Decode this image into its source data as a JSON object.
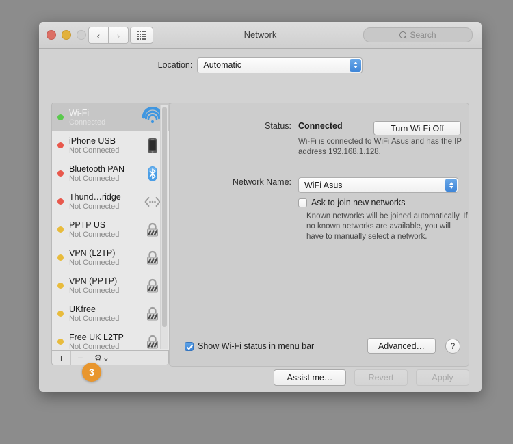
{
  "window": {
    "title": "Network",
    "traffic_lights": [
      "close",
      "minimize",
      "zoom"
    ],
    "nav_back_icon": "chevron-left-icon",
    "nav_forward_icon": "chevron-right-icon",
    "show_all_icon": "grid-icon",
    "search_placeholder": "Search"
  },
  "location": {
    "label": "Location:",
    "value": "Automatic"
  },
  "sidebar": {
    "services": [
      {
        "name": "Wi-Fi",
        "status": "Connected",
        "dot": "green",
        "icon": "wifi-icon",
        "selected": true
      },
      {
        "name": "iPhone USB",
        "status": "Not Connected",
        "dot": "red",
        "icon": "iphone-icon",
        "selected": false
      },
      {
        "name": "Bluetooth PAN",
        "status": "Not Connected",
        "dot": "red",
        "icon": "bluetooth-icon",
        "selected": false
      },
      {
        "name": "Thund…ridge",
        "status": "Not Connected",
        "dot": "red",
        "icon": "thunderbolt-icon",
        "selected": false
      },
      {
        "name": "PPTP US",
        "status": "Not Connected",
        "dot": "yellow",
        "icon": "vpn-lock-icon",
        "selected": false
      },
      {
        "name": "VPN (L2TP)",
        "status": "Not Connected",
        "dot": "yellow",
        "icon": "vpn-lock-icon",
        "selected": false
      },
      {
        "name": "VPN (PPTP)",
        "status": "Not Connected",
        "dot": "yellow",
        "icon": "vpn-lock-icon",
        "selected": false
      },
      {
        "name": "UKfree",
        "status": "Not Connected",
        "dot": "yellow",
        "icon": "vpn-lock-icon",
        "selected": false
      },
      {
        "name": "Free UK L2TP",
        "status": "Not Connected",
        "dot": "yellow",
        "icon": "vpn-lock-icon",
        "selected": false
      }
    ],
    "toolbar": {
      "add_label": "+",
      "remove_label": "−",
      "action_icon": "gear-icon",
      "action_chevron": "⌄"
    }
  },
  "annotation": {
    "badge_number": "3",
    "badge_color": "#e8962e"
  },
  "panel": {
    "status_label": "Status:",
    "status_value": "Connected",
    "turn_off_label": "Turn Wi-Fi Off",
    "status_description": "Wi-Fi is connected to WiFi Asus and has the IP address 192.168.1.128.",
    "network_name_label": "Network Name:",
    "network_name_value": "WiFi Asus",
    "ask_to_join_label": "Ask to join new networks",
    "ask_to_join_checked": false,
    "help_text": "Known networks will be joined automatically. If no known networks are available, you will have to manually select a network.",
    "show_status_label": "Show Wi-Fi status in menu bar",
    "show_status_checked": true,
    "advanced_label": "Advanced…",
    "help_button_label": "?"
  },
  "footer": {
    "assist_label": "Assist me…",
    "revert_label": "Revert",
    "apply_label": "Apply"
  },
  "colors": {
    "accent_blue": "#3c83d6",
    "connected_green": "#5ac94d",
    "disconnected_red": "#e8584c",
    "vpn_yellow": "#e8bb3c",
    "badge_orange": "#e8962e"
  }
}
